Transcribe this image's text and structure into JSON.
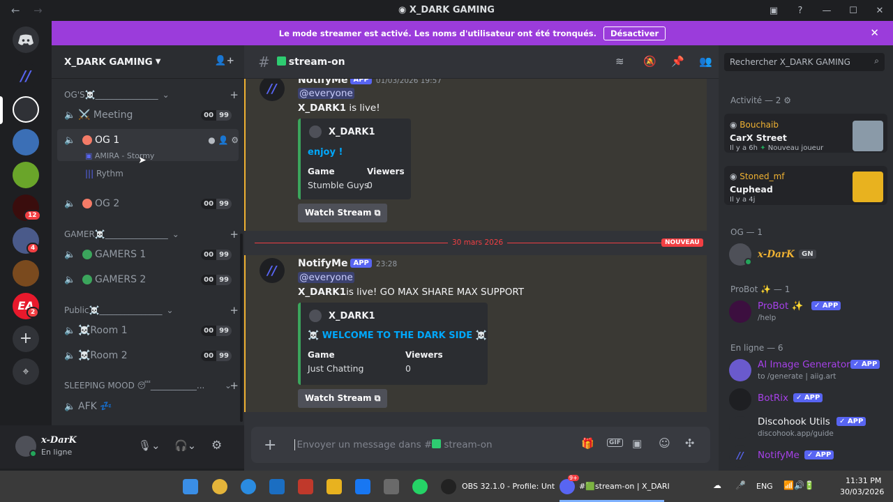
{
  "window": {
    "title": "X_DARK GAMING",
    "back": "←",
    "forward": "→"
  },
  "banner": {
    "text": "Le mode streamer est activé. Les noms d'utilisateur ont été tronqués.",
    "button": "Désactiver"
  },
  "server": {
    "name": "X_DARK GAMING",
    "categories": [
      {
        "name": "OG'S☠️_______________"
      },
      {
        "name": "GAMER☠️_______________"
      },
      {
        "name": "Public☠️_______________"
      },
      {
        "name": "SLEEPING MOOD 😴___________..."
      }
    ],
    "channels": {
      "meeting": {
        "name": "⚔️ Meeting",
        "count": "00",
        "limit": "99"
      },
      "og1": {
        "name": "OG 1"
      },
      "og2": {
        "name": "OG 2",
        "count": "00",
        "limit": "99"
      },
      "gamers1": {
        "name": "GAMERS 1",
        "count": "00",
        "limit": "99"
      },
      "gamers2": {
        "name": "GAMERS 2",
        "count": "00",
        "limit": "99"
      },
      "room1": {
        "name": "☠️Room 1",
        "count": "00",
        "limit": "99"
      },
      "room2": {
        "name": "☠️Room 2",
        "count": "00",
        "limit": "99"
      },
      "afk": {
        "name": "AFK 💤"
      }
    },
    "og1_users": [
      "AMIRA - Stormy",
      "Rythm"
    ]
  },
  "user": {
    "name": "x-DarK",
    "status": "En ligne"
  },
  "channel": {
    "name": "stream-on"
  },
  "messages": {
    "m1": {
      "author": "NotifyMe",
      "tag": "APP",
      "time": "01/03/2026 19:57",
      "mention": "@everyone",
      "text_bold": "X_DARK1",
      "text": " is live!",
      "embed": {
        "author": "X_DARK1",
        "title": "enjoy !",
        "f1n": "Game",
        "f1v": "Stumble Guys",
        "f2n": "Viewers",
        "f2v": "0"
      },
      "button": "Watch Stream"
    },
    "divider": {
      "date": "30 mars 2026",
      "badge": "NOUVEAU"
    },
    "m2": {
      "author": "NotifyMe",
      "tag": "APP",
      "time": "23:28",
      "mention": "@everyone",
      "text_bold": "X_DARK1",
      "text": "is live! GO MAX SHARE MAX SUPPORT",
      "embed": {
        "author": "X_DARK1",
        "title": "WELCOME TO THE DARK SIDE",
        "deco": "☠️",
        "f1n": "Game",
        "f1v": "Just Chatting",
        "f2n": "Viewers",
        "f2v": "0"
      },
      "button": "Watch Stream"
    }
  },
  "composer": {
    "placeholder": "Envoyer un message dans #",
    "channel": "stream-on"
  },
  "search": {
    "placeholder": "Rechercher X_DARK GAMING"
  },
  "members": {
    "activity_header": "Activité — 2",
    "activities": [
      {
        "name": "Bouchaib",
        "game": "CarX Street",
        "meta": "Il y a 6h",
        "extra": "Nouveau joueur"
      },
      {
        "name": "Stoned_mf",
        "game": "Cuphead",
        "meta": "Il y a 4j"
      }
    ],
    "og_header": "OG — 1",
    "og_member": {
      "name": "x-DarK",
      "tag": "GN"
    },
    "probot_header": "ProBot ✨ — 1",
    "probot": {
      "name": "ProBot ✨",
      "tag": "APP",
      "sub": "/help"
    },
    "online_header": "En ligne — 6",
    "online": [
      {
        "name": "AI Image Generator",
        "tag": "APP",
        "sub": "to /generate | aiig.art"
      },
      {
        "name": "BotRix",
        "tag": "APP",
        "sub": ""
      },
      {
        "name": "Discohook Utils",
        "tag": "APP",
        "sub": "discohook.app/guide"
      },
      {
        "name": "NotifyMe",
        "tag": "APP",
        "sub": ""
      }
    ]
  },
  "taskbar": {
    "obs": "OBS 32.1.0 - Profile: Unt",
    "discord": "#🟩stream-on | X_DARI",
    "lang": "ENG",
    "time": "11:31 PM",
    "date": "30/03/2026",
    "discord_badge": "9+"
  },
  "guild_badges": [
    "12",
    "4",
    "2"
  ],
  "colors": {
    "accent": "#5865f2",
    "banner": "#9b3cdb",
    "online": "#23a55a",
    "mention_bar": "#f0b232",
    "new_line": "#f23f43"
  },
  "icons": [
    "discord-icon",
    "speaker-icon",
    "gear-icon",
    "search-icon",
    "gift-icon",
    "gif-icon",
    "sticker-icon",
    "emoji-icon",
    "apps-icon",
    "mic-icon",
    "headphones-icon",
    "pin-icon",
    "members-icon",
    "threads-icon",
    "mute-icon",
    "plus-icon",
    "explore-icon",
    "invite-icon"
  ]
}
